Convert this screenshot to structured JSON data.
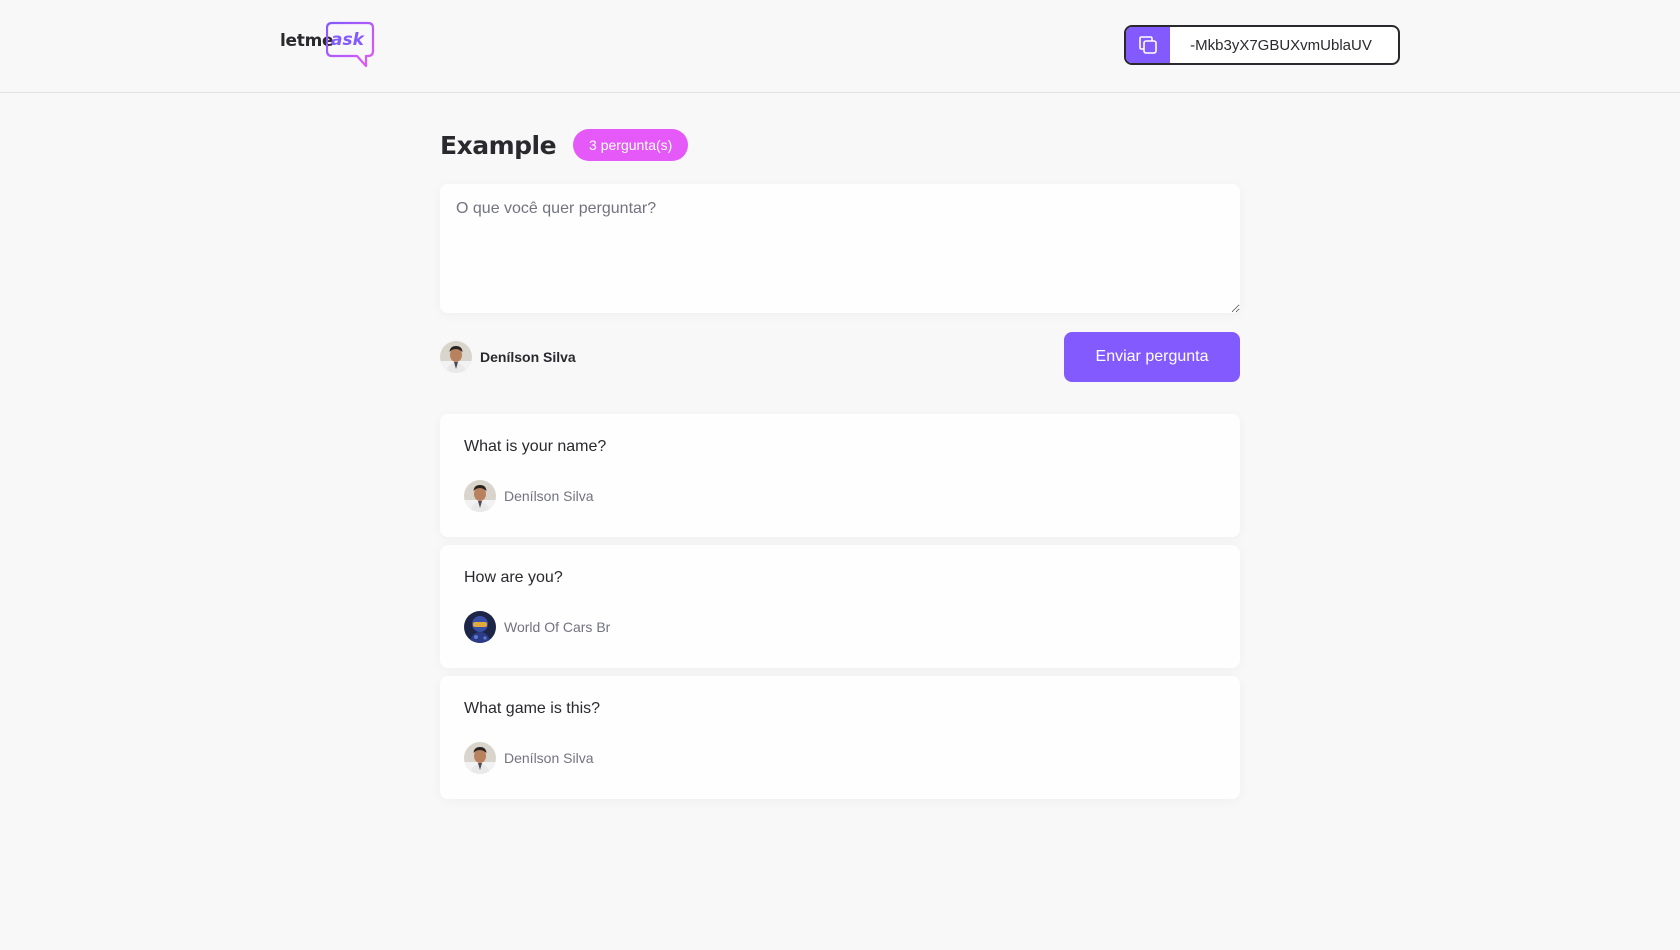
{
  "header": {
    "logo": {
      "text_main": "letme",
      "text_accent": "ask"
    },
    "room_code": {
      "icon": "copy-icon",
      "code": "-Mkb3yX7GBUXvmUblaUV"
    }
  },
  "room": {
    "title": "Example",
    "question_count_badge": "3 pergunta(s)"
  },
  "form": {
    "placeholder": "O que você quer perguntar?",
    "value": "",
    "user_name": "Denílson Silva",
    "submit_label": "Enviar pergunta"
  },
  "questions": [
    {
      "content": "What is your name?",
      "author": "Denílson Silva",
      "avatar": "avatar-denilson"
    },
    {
      "content": "How are you?",
      "author": "World Of Cars Br",
      "avatar": "avatar-world-of-cars"
    },
    {
      "content": "What game is this?",
      "author": "Denílson Silva",
      "avatar": "avatar-denilson"
    }
  ],
  "colors": {
    "brand": "#835afd",
    "badge": "#e559f9",
    "text": "#29292e",
    "muted": "#737380",
    "background": "#f8f8f8"
  }
}
